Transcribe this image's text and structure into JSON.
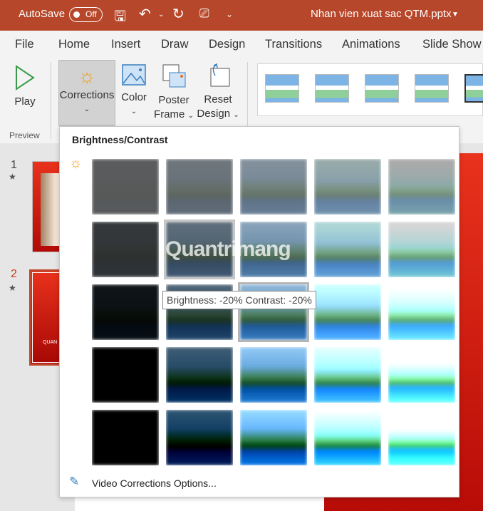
{
  "titlebar": {
    "autosave": "AutoSave",
    "toggle": "Off",
    "filename": "Nhan vien xuat sac QTM.pptx"
  },
  "tabs": [
    "File",
    "Home",
    "Insert",
    "Draw",
    "Design",
    "Transitions",
    "Animations",
    "Slide Show"
  ],
  "ribbon": {
    "play": "Play",
    "preview": "Preview",
    "corrections": "Corrections",
    "color": "Color",
    "poster1": "Poster",
    "poster2": "Frame",
    "reset1": "Reset",
    "reset2": "Design"
  },
  "slides": [
    {
      "num": "1"
    },
    {
      "num": "2",
      "text": "QUAN"
    }
  ],
  "dropdown": {
    "heading": "Brightness/Contrast",
    "footer": "Video Corrections Options...",
    "tooltip": "Brightness: -20% Contrast: -20%",
    "brightness": [
      -40,
      -20,
      0,
      20,
      40
    ],
    "contrast": [
      -40,
      -20,
      0,
      20,
      40
    ],
    "selected": [
      1,
      1
    ],
    "hovered": [
      2,
      2
    ]
  },
  "watermark": "Quantrimang",
  "colors": {
    "titlebar": "#b7472a",
    "accent": "#c43e1c"
  }
}
